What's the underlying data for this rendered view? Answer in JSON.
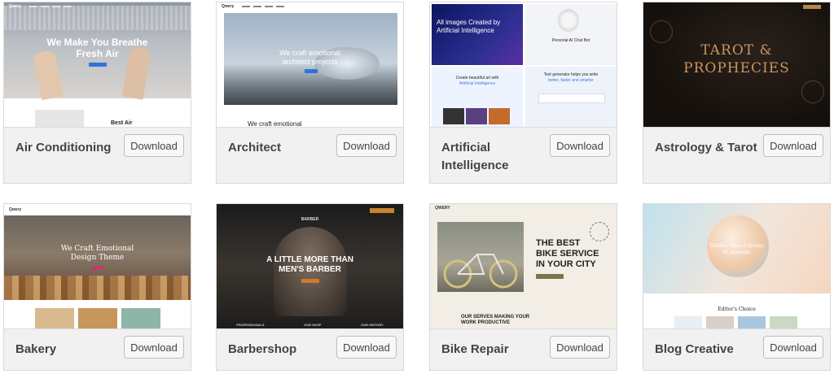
{
  "cards": [
    {
      "title": "Air Conditioning",
      "download": "Download",
      "preview": {
        "logo": "Qwery",
        "heading_line1": "We Make You Breathe",
        "heading_line2": "Fresh Air",
        "sub_heading": "Best Air"
      }
    },
    {
      "title": "Architect",
      "download": "Download",
      "preview": {
        "logo": "Qwery",
        "heading_line1": "We craft emotional",
        "heading_line2": "architect projects",
        "sub_heading": "We craft emotional"
      }
    },
    {
      "title": "Artificial Intelligence",
      "download": "Download",
      "preview": {
        "heading_line1": "All images Created by",
        "heading_line2": "Artificial Intelligence",
        "chat_title": "Personal AI Chat Bot",
        "art_line1": "Create beautiful art with",
        "art_line2": "Artificial Intelligence",
        "text_line1": "Text generator helps you write",
        "text_line2": "better, faster and smarter"
      }
    },
    {
      "title": "Astrology & Tarot",
      "download": "Download",
      "preview": {
        "heading_line1": "TAROT &",
        "heading_line2": "PROPHECIES"
      }
    },
    {
      "title": "Bakery",
      "download": "Download",
      "preview": {
        "logo": "Qwery",
        "heading_line1": "We Craft Emotional",
        "heading_line2": "Design Theme"
      }
    },
    {
      "title": "Barbershop",
      "download": "Download",
      "preview": {
        "logo": "BARBER",
        "heading_line1": "A LITTLE MORE THAN",
        "heading_line2": "MEN'S BARBER",
        "col1": "PROFESSIONALS",
        "col2": "OUR SHOP",
        "col3": "OUR HISTORY"
      }
    },
    {
      "title": "Bike Repair",
      "download": "Download",
      "preview": {
        "logo": "QWERY",
        "heading_line1": "THE BEST",
        "heading_line2": "BIKE SERVICE",
        "heading_line3": "IN YOUR CITY",
        "sub_line1": "OUR SERVES MAKING YOUR",
        "sub_line2": "WORK PRODUCTIVE"
      }
    },
    {
      "title": "Blog Creative",
      "download": "Download",
      "preview": {
        "heading_line1": "Hidden idea of design",
        "heading_line2": "of pleasure",
        "section_title": "Editor's Choice"
      }
    }
  ]
}
